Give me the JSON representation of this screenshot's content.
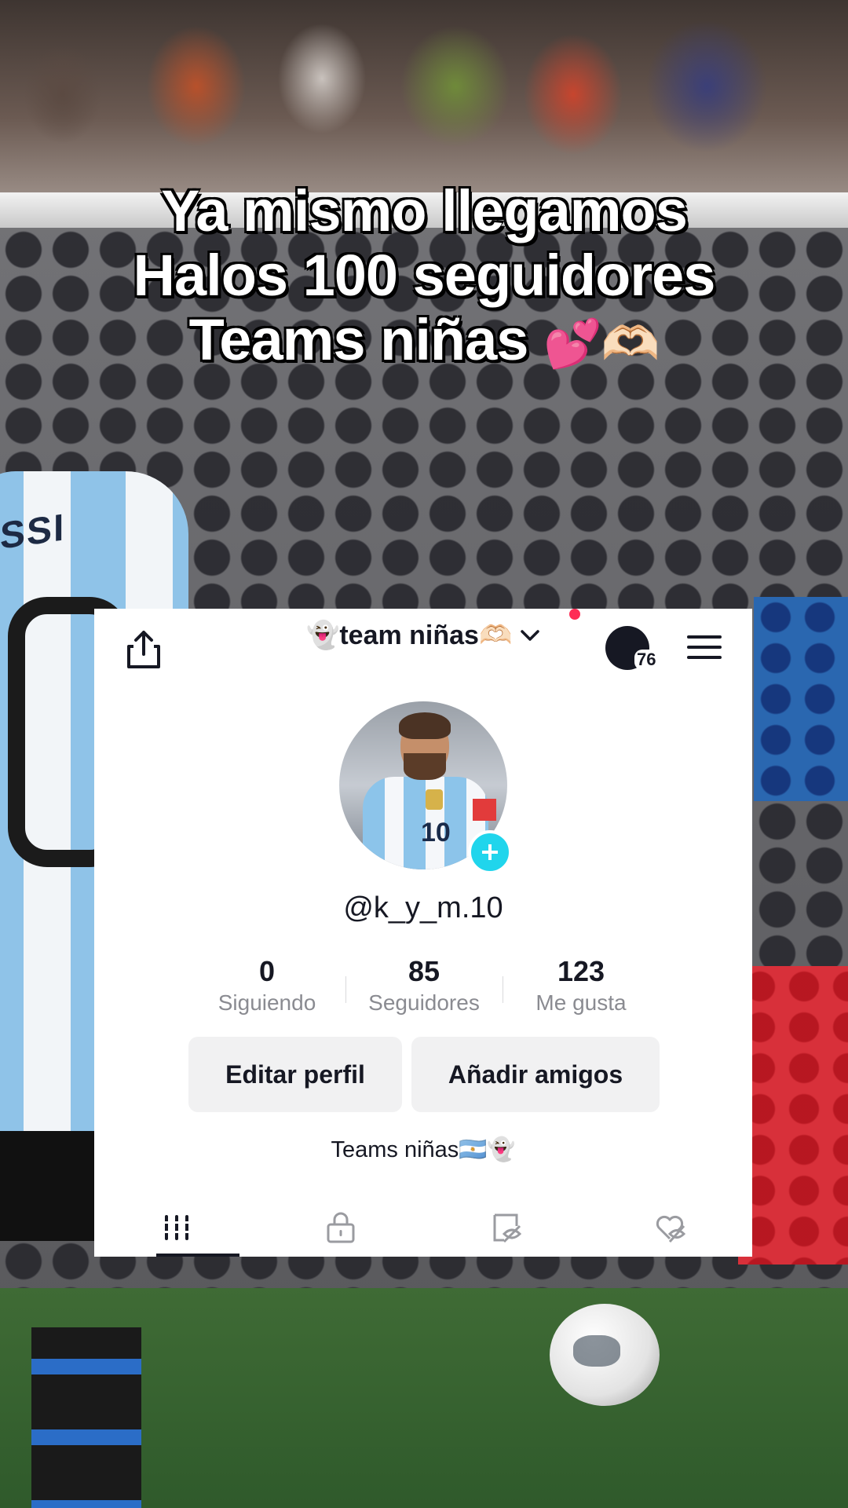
{
  "caption": {
    "line1": "Ya mismo llegamos",
    "line2": "Halos 100 seguidores",
    "line3": "Teams niñas",
    "line3_emojis": "💕🫶🏻"
  },
  "background": {
    "jersey_text": "SSI"
  },
  "profile": {
    "account_name": "👻team niñas🫶🏻",
    "notification_count": "76",
    "username": "@k_y_m.10",
    "avatar_jersey_number": "10",
    "stats": [
      {
        "value": "0",
        "label": "Siguiendo"
      },
      {
        "value": "85",
        "label": "Seguidores"
      },
      {
        "value": "123",
        "label": "Me gusta"
      }
    ],
    "buttons": {
      "edit": "Editar perfil",
      "add_friends": "Añadir amigos"
    },
    "bio": "Teams niñas🇦🇷👻",
    "tabs": [
      {
        "icon": "videos-grid-icon",
        "active": true
      },
      {
        "icon": "private-lock-icon",
        "active": false
      },
      {
        "icon": "hidden-reposts-icon",
        "active": false
      },
      {
        "icon": "hidden-likes-icon",
        "active": false
      }
    ]
  },
  "colors": {
    "add_button": "#20d5ec",
    "notification_dot": "#fe2c55",
    "text_primary": "#161823",
    "text_secondary": "#8a8b91",
    "button_bg": "#f1f1f2"
  }
}
